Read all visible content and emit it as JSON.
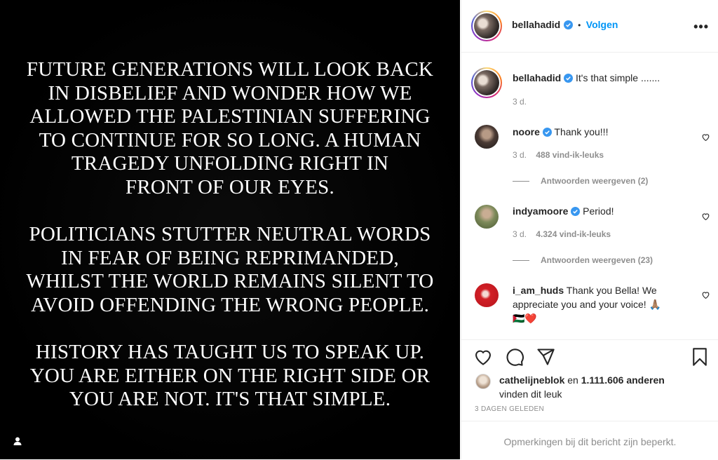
{
  "post": {
    "quote_lines": [
      "FUTURE GENERATIONS WILL LOOK BACK",
      "IN DISBELIEF AND WONDER HOW WE",
      "ALLOWED THE PALESTINIAN SUFFERING",
      "TO CONTINUE FOR SO LONG. A HUMAN",
      "TRAGEDY UNFOLDING RIGHT IN",
      "FRONT OF OUR EYES.",
      "POLITICIANS STUTTER NEUTRAL WORDS",
      "IN FEAR OF BEING REPRIMANDED,",
      "WHILST THE WORLD REMAINS SILENT  TO",
      "AVOID OFFENDING THE WRONG PEOPLE.",
      "HISTORY HAS TAUGHT US TO SPEAK UP.",
      "YOU ARE EITHER ON THE RIGHT SIDE OR",
      "YOU ARE NOT.  IT'S THAT SIMPLE."
    ],
    "tag_icon": "user-tag-icon"
  },
  "header": {
    "username": "bellahadid",
    "separator": "•",
    "follow_label": "Volgen",
    "more_label": "•••"
  },
  "caption": {
    "username": "bellahadid",
    "text": "It's that simple .......",
    "time": "3 d."
  },
  "comments": [
    {
      "username": "noore",
      "verified": true,
      "text": "Thank you!!!",
      "time": "3 d.",
      "likes": "488 vind-ik-leuks",
      "replies": "Antwoorden weergeven (2)"
    },
    {
      "username": "indyamoore",
      "verified": true,
      "text": "Period!",
      "time": "3 d.",
      "likes": "4.324 vind-ik-leuks",
      "replies": "Antwoorden weergeven (23)"
    },
    {
      "username": "i_am_huds",
      "verified": false,
      "text_line1": "Thank you Bella! We",
      "text_line2": "appreciate you and your voice! 🙏🏽",
      "text_line3": "🇵🇸❤️"
    }
  ],
  "likes": {
    "liker": "cathelijneblok",
    "connector": "en",
    "count": "1.111.606 anderen",
    "suffix": "vinden dit leuk"
  },
  "date": "3 DAGEN GELEDEN",
  "footer_text": "Opmerkingen bij dit bericht zijn beperkt.",
  "colors": {
    "accent": "#0095f6",
    "verified": "#3897f0",
    "muted": "#8e8e8e",
    "text": "#262626"
  }
}
